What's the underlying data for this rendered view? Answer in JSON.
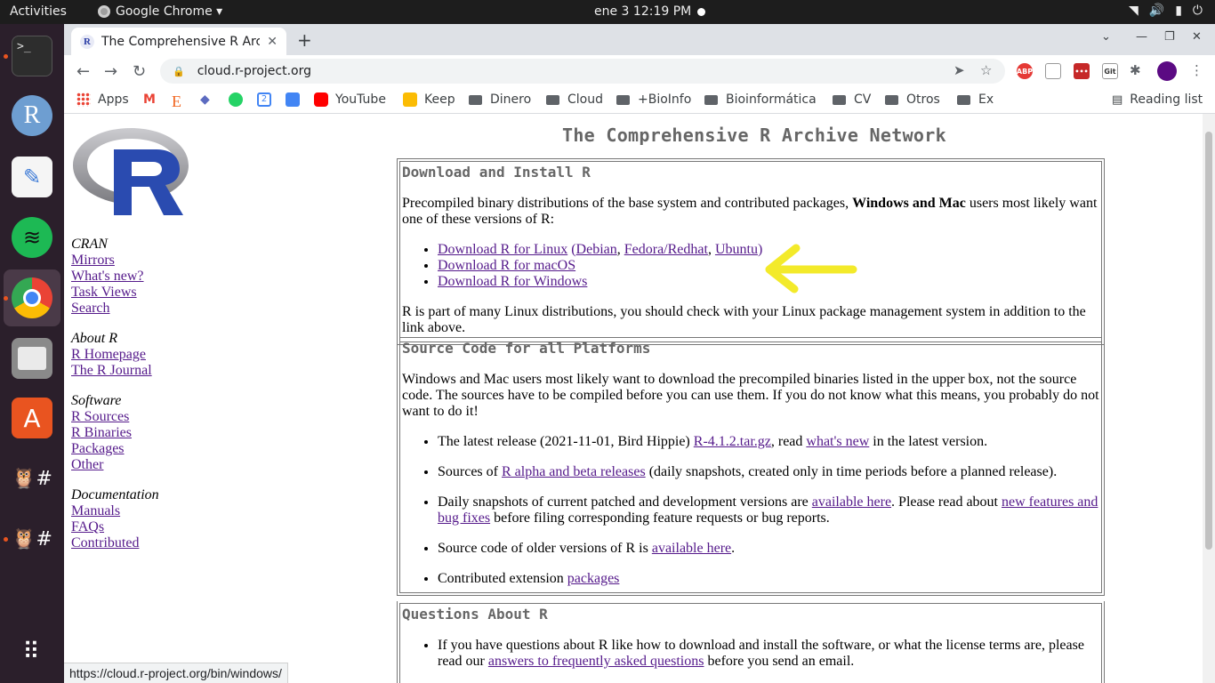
{
  "topbar": {
    "activities": "Activities",
    "app_name": "Google Chrome ▾",
    "clock": "ene 3  12:19 PM"
  },
  "browser": {
    "tab_title": "The Comprehensive R Archive Network",
    "url": "cloud.r-project.org",
    "bookmarks": [
      "Apps",
      "YouTube",
      "Keep",
      "Dinero",
      "Cloud",
      "+BioInfo",
      "Bioinformática",
      "CV",
      "Otros",
      "Ex"
    ],
    "reading_list": "Reading list",
    "status_url": "https://cloud.r-project.org/bin/windows/"
  },
  "page": {
    "title": "The Comprehensive R Archive Network",
    "sidebar": {
      "cran": {
        "header": "CRAN",
        "links": [
          "Mirrors",
          "What's new?",
          "Task Views",
          "Search"
        ]
      },
      "about": {
        "header": "About R",
        "links": [
          "R Homepage",
          "The R Journal"
        ]
      },
      "software": {
        "header": "Software",
        "links": [
          "R Sources",
          "R Binaries",
          "Packages",
          "Other"
        ]
      },
      "documentation": {
        "header": "Documentation",
        "links": [
          "Manuals",
          "FAQs",
          "Contributed"
        ]
      }
    },
    "download": {
      "heading": "Download and Install R",
      "intro_a": "Precompiled binary distributions of the base system and contributed packages, ",
      "intro_bold": "Windows and Mac",
      "intro_b": " users most likely want one of these versions of R:",
      "linux": "Download R for Linux",
      "debian": "Debian",
      "fedora": "Fedora/Redhat",
      "ubuntu": "Ubuntu",
      "macos": "Download R for macOS",
      "windows": "Download R for Windows",
      "outro": "R is part of many Linux distributions, you should check with your Linux package management system in addition to the link above."
    },
    "source": {
      "heading": "Source Code for all Platforms",
      "intro": "Windows and Mac users most likely want to download the precompiled binaries listed in the upper box, not the source code. The sources have to be compiled before you can use them. If you do not know what this means, you probably do not want to do it!",
      "i1_a": "The latest release (2021-11-01, Bird Hippie) ",
      "i1_link": "R-4.1.2.tar.gz",
      "i1_b": ", read ",
      "i1_link2": "what's new",
      "i1_c": " in the latest version.",
      "i2_a": "Sources of ",
      "i2_link": "R alpha and beta releases",
      "i2_b": " (daily snapshots, created only in time periods before a planned release).",
      "i3_a": "Daily snapshots of current patched and development versions are ",
      "i3_link": "available here",
      "i3_b": ". Please read about ",
      "i3_link2": "new features and bug fixes",
      "i3_c": " before filing corresponding feature requests or bug reports.",
      "i4_a": "Source code of older versions of R is ",
      "i4_link": "available here",
      "i4_b": ".",
      "i5_a": "Contributed extension ",
      "i5_link": "packages"
    },
    "questions": {
      "heading": "Questions About R",
      "i1_a": "If you have questions about R like how to download and install the software, or what the license terms are, please read our ",
      "i1_link": "answers to frequently asked questions",
      "i1_b": " before you send an email."
    }
  },
  "colors": {
    "link": "#551a8b",
    "heading": "#666666",
    "annotation_arrow": "#f3ea2a"
  }
}
